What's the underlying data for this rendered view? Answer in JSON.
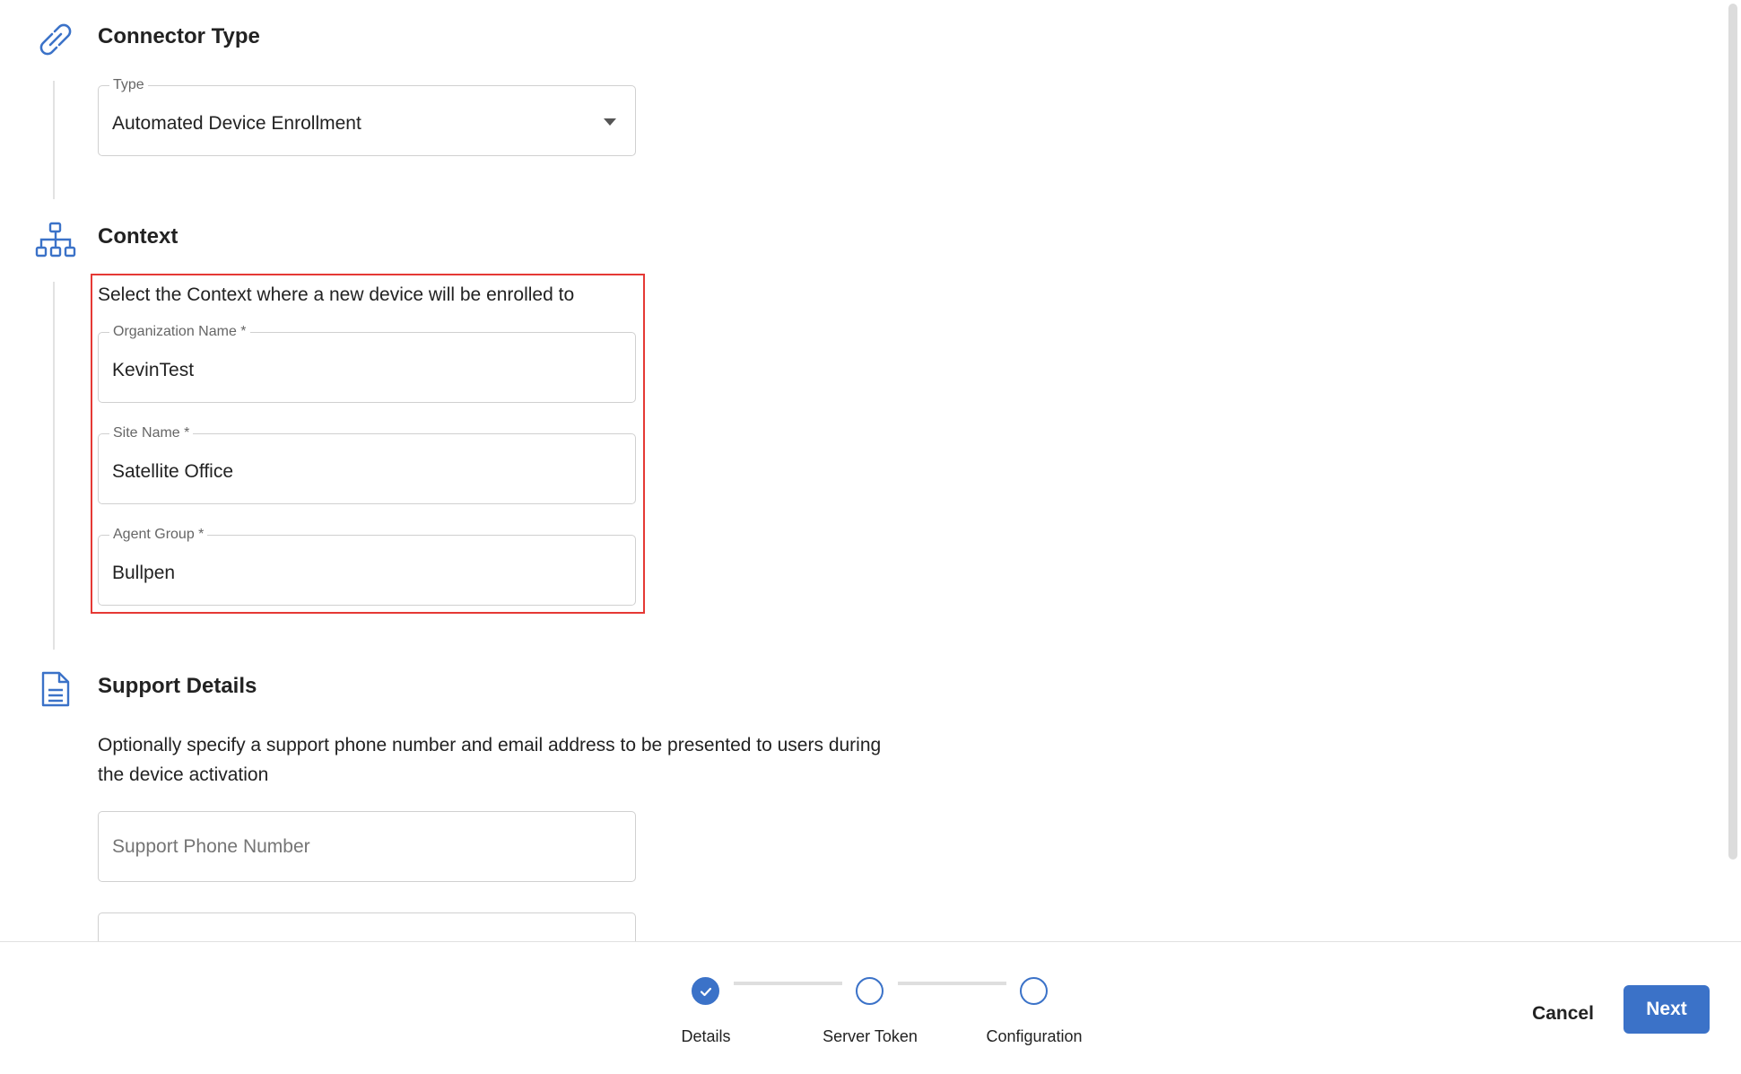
{
  "sections": {
    "connector_type": {
      "icon": "link-icon",
      "title": "Connector Type",
      "type_field": {
        "label": "Type",
        "value": "Automated Device Enrollment"
      }
    },
    "context": {
      "icon": "org-chart-icon",
      "title": "Context",
      "description": "Select the Context where a new device will be enrolled to",
      "organization": {
        "label": "Organization Name *",
        "value": "KevinTest"
      },
      "site": {
        "label": "Site Name *",
        "value": "Satellite Office"
      },
      "agent_group": {
        "label": "Agent Group *",
        "value": "Bullpen"
      }
    },
    "support_details": {
      "icon": "document-icon",
      "title": "Support Details",
      "description": "Optionally specify a support phone number and email address to be presented to users during the device activation",
      "phone": {
        "placeholder": "Support Phone Number"
      }
    }
  },
  "stepper": {
    "steps": [
      {
        "label": "Details",
        "status": "complete"
      },
      {
        "label": "Server Token",
        "status": "pending"
      },
      {
        "label": "Configuration",
        "status": "pending"
      }
    ]
  },
  "actions": {
    "cancel_label": "Cancel",
    "next_label": "Next"
  },
  "colors": {
    "accent": "#3b72c8",
    "highlight": "#e53935"
  }
}
